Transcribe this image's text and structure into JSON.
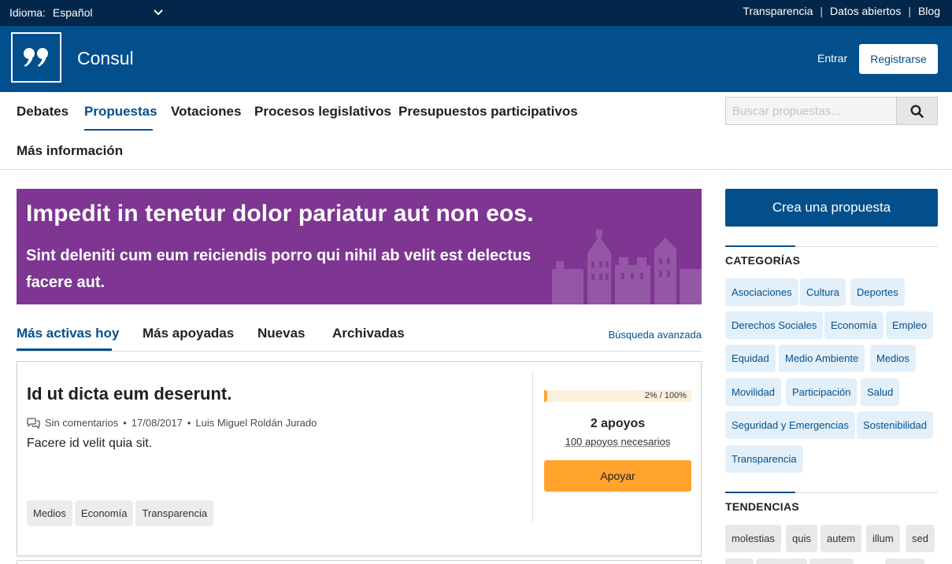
{
  "topbar": {
    "language_label": "Idioma:",
    "language_value": "Español",
    "links": [
      "Transparencia",
      "Datos abiertos",
      "Blog"
    ]
  },
  "header": {
    "site_name": "Consul",
    "login": "Entrar",
    "register": "Registrarse"
  },
  "nav": {
    "items": [
      "Debates",
      "Propuestas",
      "Votaciones",
      "Procesos legislativos",
      "Presupuestos participativos",
      "Más información"
    ],
    "active": "Propuestas",
    "search_placeholder": "Buscar propuestas..."
  },
  "banner": {
    "title": "Impedit in tenetur dolor pariatur aut non eos.",
    "description": "Sint deleniti cum eum reiciendis porro qui nihil ab velit est delectus facere aut.",
    "background_color": "#7e3692"
  },
  "tabs": {
    "items": [
      "Más activas hoy",
      "Más apoyadas",
      "Nuevas",
      "Archivadas"
    ],
    "active": "Más activas hoy",
    "advanced_search": "Búsqueda avanzada"
  },
  "proposal": {
    "title": "Id ut dicta eum deserunt.",
    "comments": "Sin comentarios",
    "date": "17/08/2017",
    "author": "Luis Miguel Roldán Jurado",
    "description": "Facere id velit quia sit.",
    "tags": [
      "Medios",
      "Economía",
      "Transparencia"
    ],
    "progress_text": "2% / 100%",
    "progress_fraction": 0.02,
    "supports": "2 apoyos",
    "needed": "100 apoyos necesarios",
    "support_button": "Apoyar"
  },
  "sidebar": {
    "create_button": "Crea una propuesta",
    "categories_heading": "CATEGORÍAS",
    "categories": [
      "Asociaciones",
      "Cultura",
      "Deportes",
      "Derechos Sociales",
      "Economía",
      "Empleo",
      "Equidad",
      "Medio Ambiente",
      "Medios",
      "Movilidad",
      "Participación",
      "Salud",
      "Seguridad y Emergencias",
      "Sostenibilidad",
      "Transparencia"
    ],
    "trends_heading": "TENDENCIAS",
    "trends": [
      "molestias",
      "quis",
      "autem",
      "illum",
      "sed"
    ]
  },
  "colors": {
    "topbar": "#02274a",
    "brand": "#034f8c",
    "accent": "#ffa32d",
    "banner": "#7e3692"
  }
}
